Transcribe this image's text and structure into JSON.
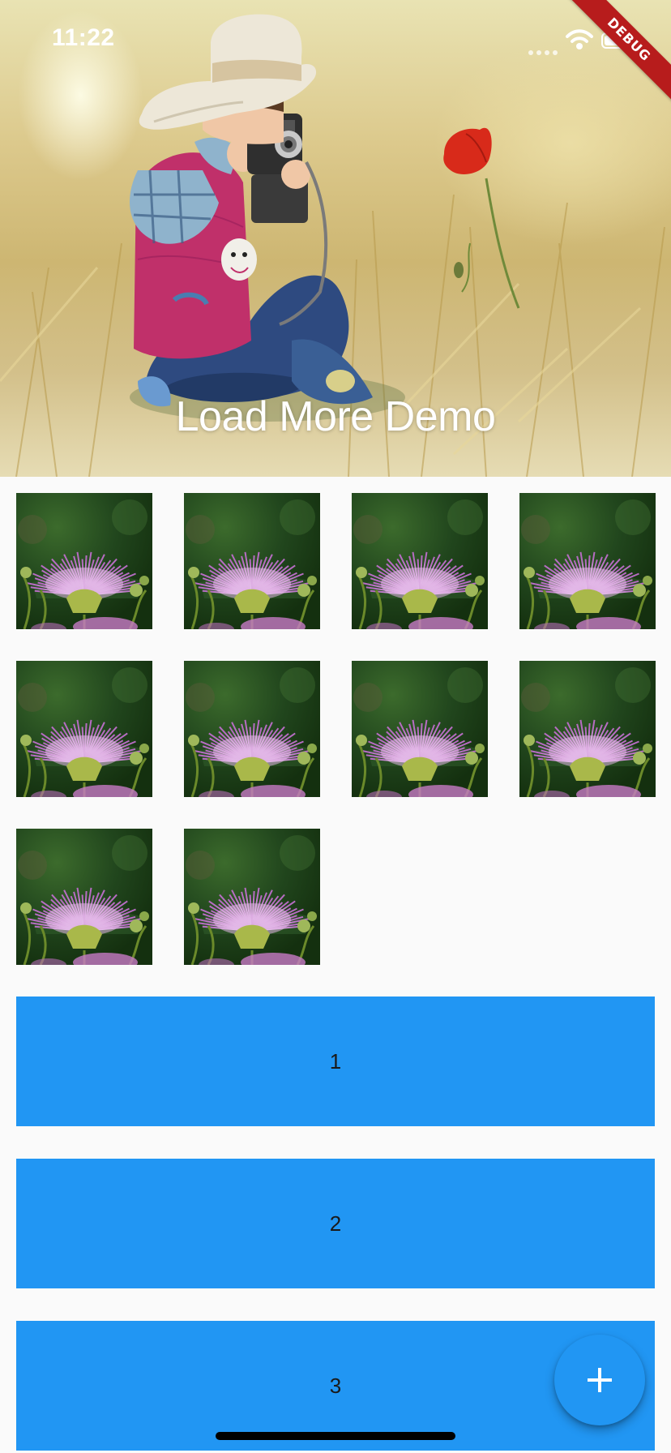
{
  "status_bar": {
    "time": "11:22"
  },
  "debug_banner": "DEBUG",
  "header": {
    "title": "Load More Demo"
  },
  "grid": {
    "tile_count": 10,
    "columns": 4,
    "image_name": "pink-flower-photo"
  },
  "list": {
    "items": [
      {
        "label": "1"
      },
      {
        "label": "2"
      },
      {
        "label": "3"
      }
    ]
  },
  "fab": {
    "icon": "plus-icon"
  },
  "colors": {
    "accent": "#2196f3",
    "background": "#fafafa",
    "banner": "#b71c1c"
  }
}
